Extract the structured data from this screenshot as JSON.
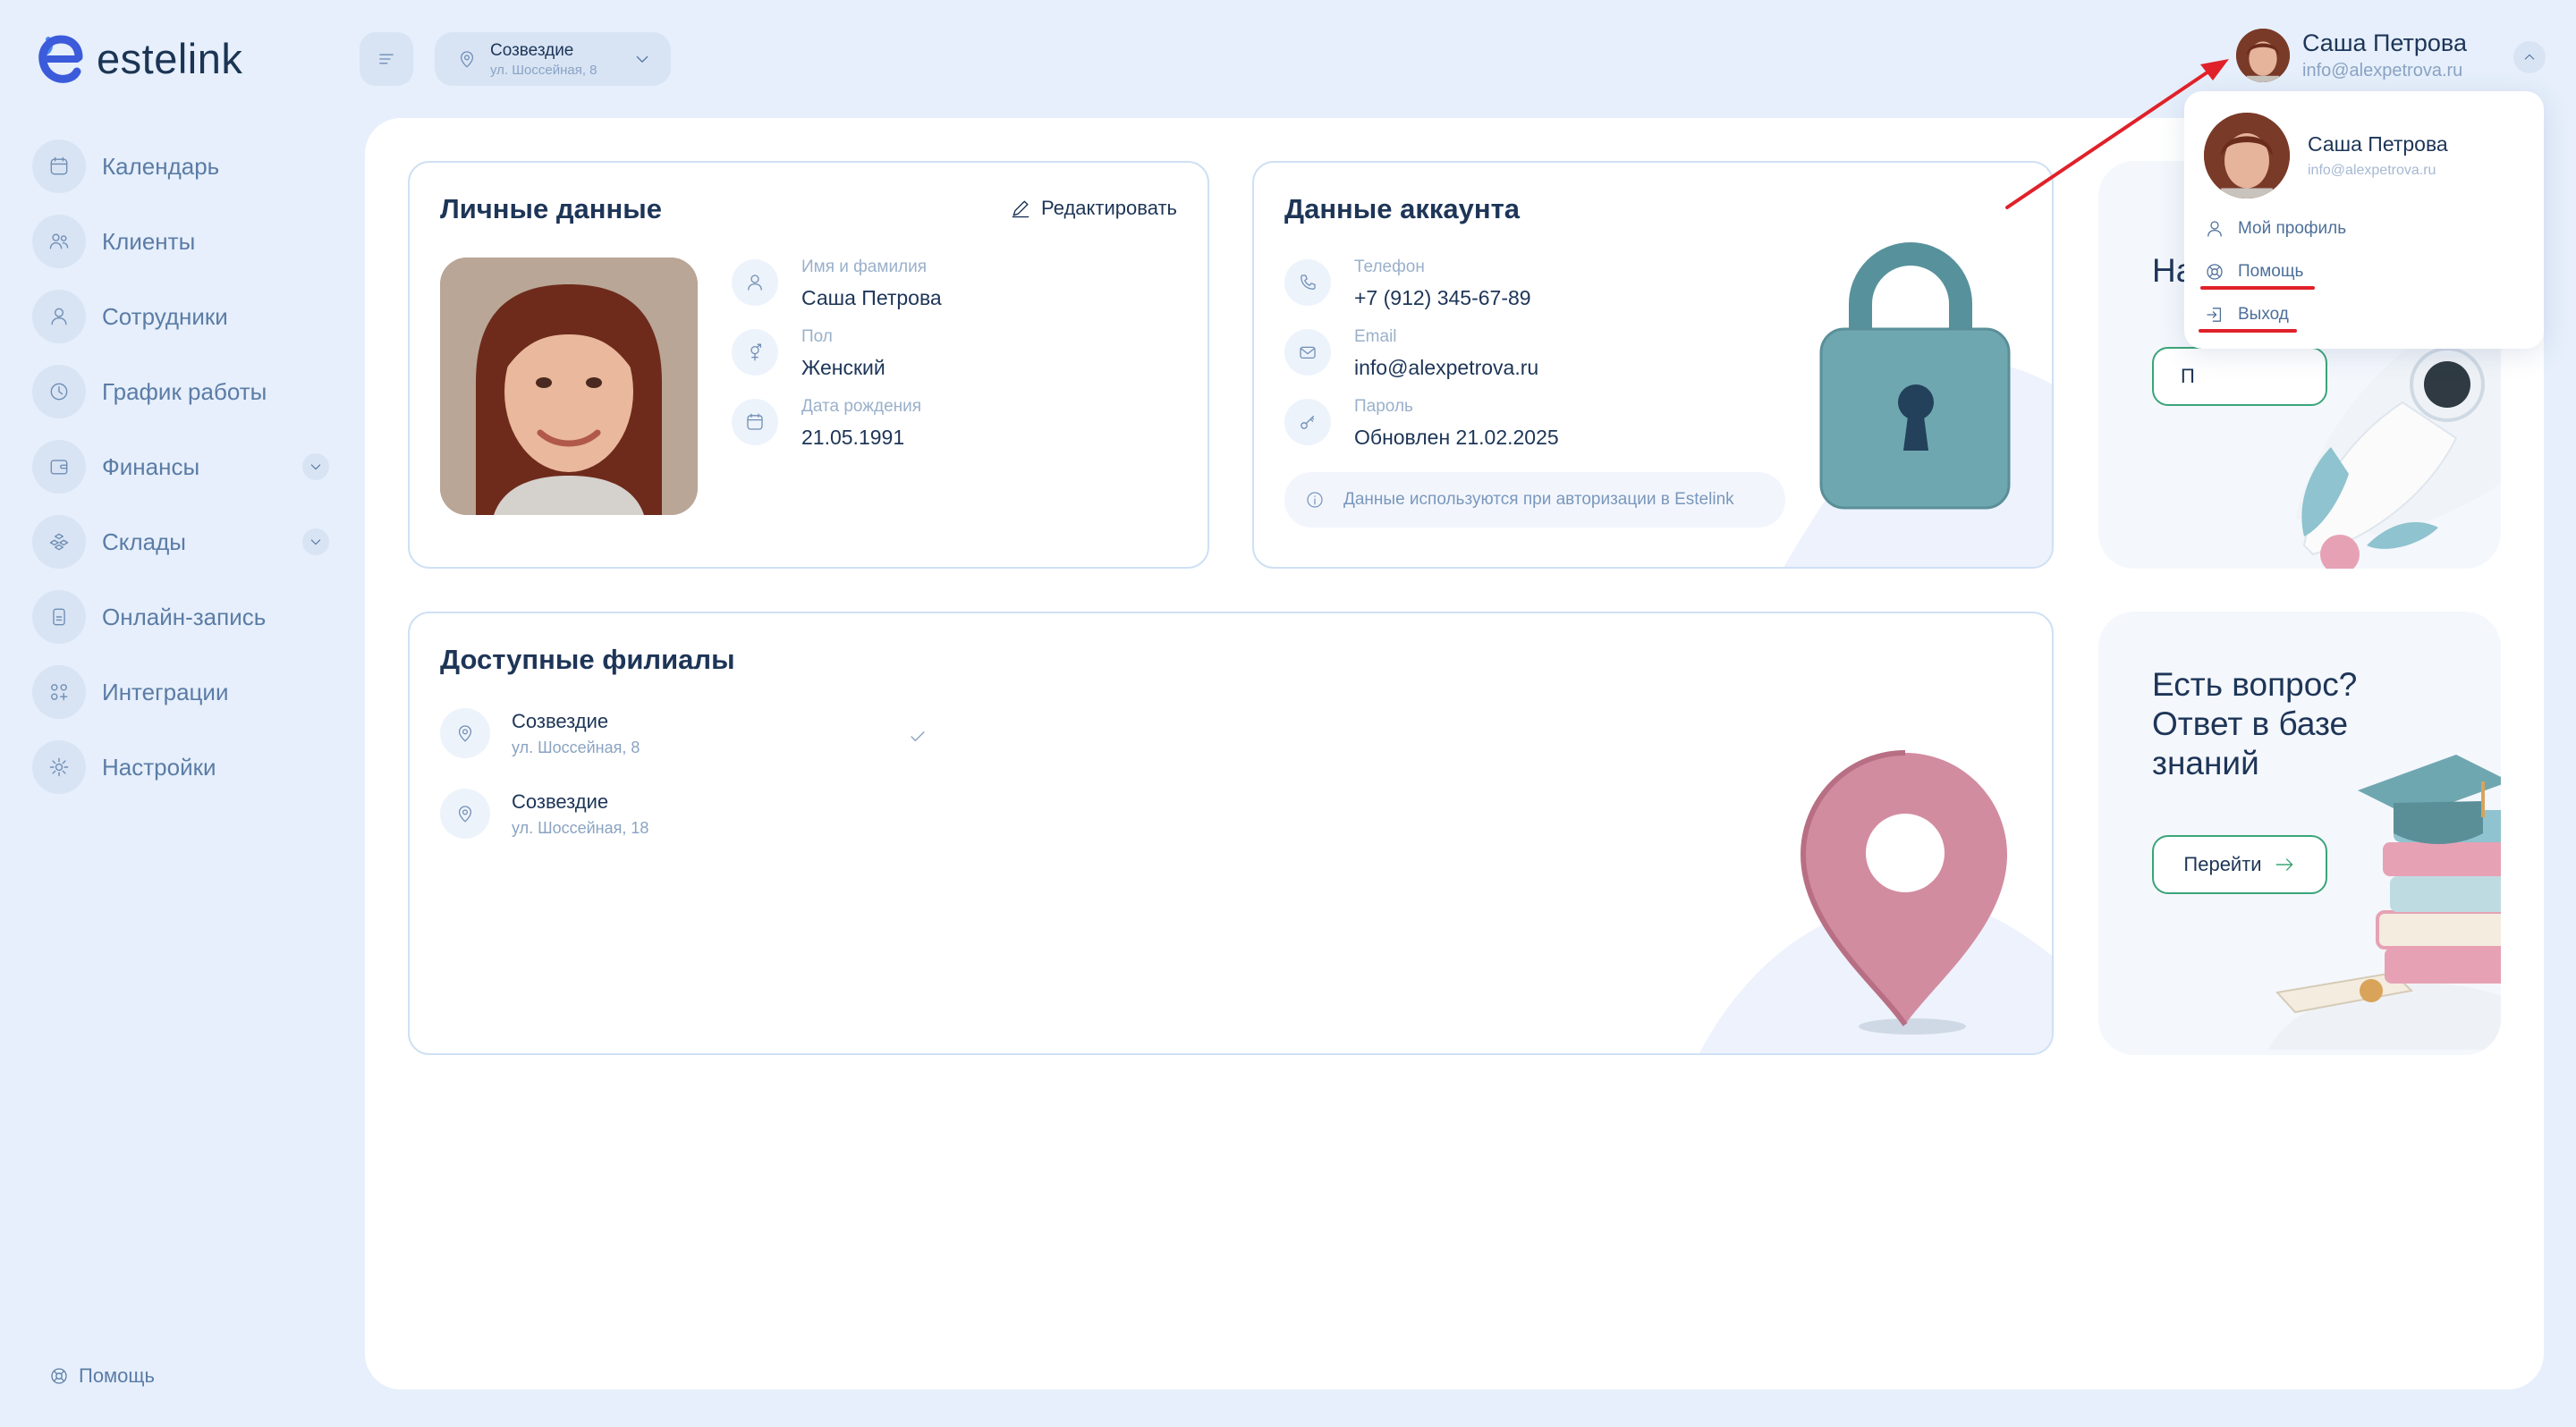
{
  "app": {
    "name": "estelink"
  },
  "sidebar": {
    "items": [
      {
        "label": "Календарь",
        "icon": "calendar-icon"
      },
      {
        "label": "Клиенты",
        "icon": "users-icon"
      },
      {
        "label": "Сотрудники",
        "icon": "user-icon"
      },
      {
        "label": "График работы",
        "icon": "clock-icon"
      },
      {
        "label": "Финансы",
        "icon": "wallet-icon",
        "expandable": true
      },
      {
        "label": "Склады",
        "icon": "boxes-icon",
        "expandable": true
      },
      {
        "label": "Онлайн-запись",
        "icon": "phone-icon"
      },
      {
        "label": "Интеграции",
        "icon": "grid-plus-icon"
      },
      {
        "label": "Настройки",
        "icon": "gear-icon"
      }
    ],
    "help_label": "Помощь"
  },
  "topbar": {
    "branch": {
      "name": "Созвездие",
      "address": "ул. Шоссейная, 8"
    },
    "user": {
      "name": "Саша Петрова",
      "email": "info@alexpetrova.ru"
    }
  },
  "personal": {
    "title": "Личные данные",
    "edit_label": "Редактировать",
    "fields": [
      {
        "label": "Имя и фамилия",
        "value": "Саша Петрова",
        "icon": "user-icon"
      },
      {
        "label": "Пол",
        "value": "Женский",
        "icon": "gender-icon"
      },
      {
        "label": "Дата рождения",
        "value": "21.05.1991",
        "icon": "calendar-icon"
      }
    ]
  },
  "account": {
    "title": "Данные аккаунта",
    "fields": [
      {
        "label": "Телефон",
        "value": "+7 (912) 345-67-89",
        "icon": "phone-icon"
      },
      {
        "label": "Email",
        "value": "info@alexpetrova.ru",
        "icon": "mail-icon"
      },
      {
        "label": "Пароль",
        "value": "Обновлен 21.02.2025",
        "icon": "key-icon"
      }
    ],
    "note": "Данные используются при авторизации в Estelink"
  },
  "branches": {
    "title": "Доступные филиалы",
    "items": [
      {
        "name": "Созвездие",
        "address": "ул. Шоссейная, 8",
        "selected": true
      },
      {
        "name": "Созвездие",
        "address": "ул. Шоссейная, 18",
        "selected": false
      }
    ]
  },
  "promo_top": {
    "title_fragment": "На",
    "button_fragment": "П"
  },
  "promo_kb": {
    "title": "Есть вопрос? Ответ в базе знаний",
    "button_label": "Перейти"
  },
  "dropdown": {
    "name": "Саша Петрова",
    "email": "info@alexpetrova.ru",
    "items": [
      {
        "label": "Мой профиль",
        "icon": "user-icon"
      },
      {
        "label": "Помощь",
        "icon": "lifebuoy-icon"
      },
      {
        "label": "Выход",
        "icon": "logout-icon"
      }
    ]
  },
  "colors": {
    "accent": "#3aa577",
    "annotation": "#e0212a",
    "background": "#e6effb"
  }
}
